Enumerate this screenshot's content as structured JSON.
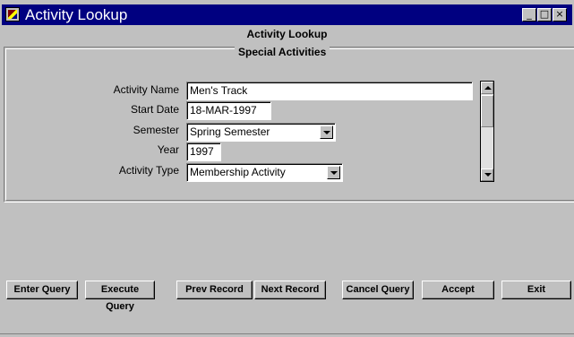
{
  "window": {
    "title": "Activity Lookup",
    "controls": {
      "minimize": "_",
      "maximize": "□",
      "close": "×"
    }
  },
  "header": {
    "title": "Activity Lookup"
  },
  "panel": {
    "title": "Special Activities"
  },
  "form": {
    "activity_name": {
      "label": "Activity Name",
      "value": "Men's Track"
    },
    "start_date": {
      "label": "Start Date",
      "value": "18-MAR-1997"
    },
    "semester": {
      "label": "Semester",
      "value": "Spring Semester"
    },
    "year": {
      "label": "Year",
      "value": "1997"
    },
    "activity_type": {
      "label": "Activity Type",
      "value": "Membership Activity"
    }
  },
  "buttons": {
    "enter_query": "Enter Query",
    "execute_query": "Execute Query",
    "prev_record": "Prev Record",
    "next_record": "Next Record",
    "cancel_query": "Cancel Query",
    "accept": "Accept",
    "exit": "Exit"
  },
  "colors": {
    "titlebar": "#000080",
    "background": "#c0c0c0",
    "field": "#ffffff"
  }
}
